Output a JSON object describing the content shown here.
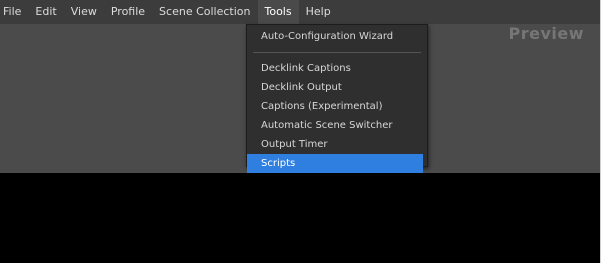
{
  "menubar": {
    "items": [
      "File",
      "Edit",
      "View",
      "Profile",
      "Scene Collection",
      "Tools",
      "Help"
    ],
    "active_index": 5
  },
  "preview": {
    "label": "Preview"
  },
  "tools_menu": {
    "items": [
      {
        "label": "Auto-Configuration Wizard",
        "selected": false
      },
      {
        "separator": true
      },
      {
        "label": "Decklink Captions",
        "selected": false
      },
      {
        "label": "Decklink Output",
        "selected": false
      },
      {
        "label": "Captions (Experimental)",
        "selected": false
      },
      {
        "label": "Automatic Scene Switcher",
        "selected": false
      },
      {
        "label": "Output Timer",
        "selected": false
      },
      {
        "label": "Scripts",
        "selected": true
      }
    ]
  },
  "colors": {
    "menubar_bg": "#3c3c3c",
    "panel_bg": "#4b4b4b",
    "canvas_bg": "#000000",
    "selection": "#2f7fe0"
  }
}
